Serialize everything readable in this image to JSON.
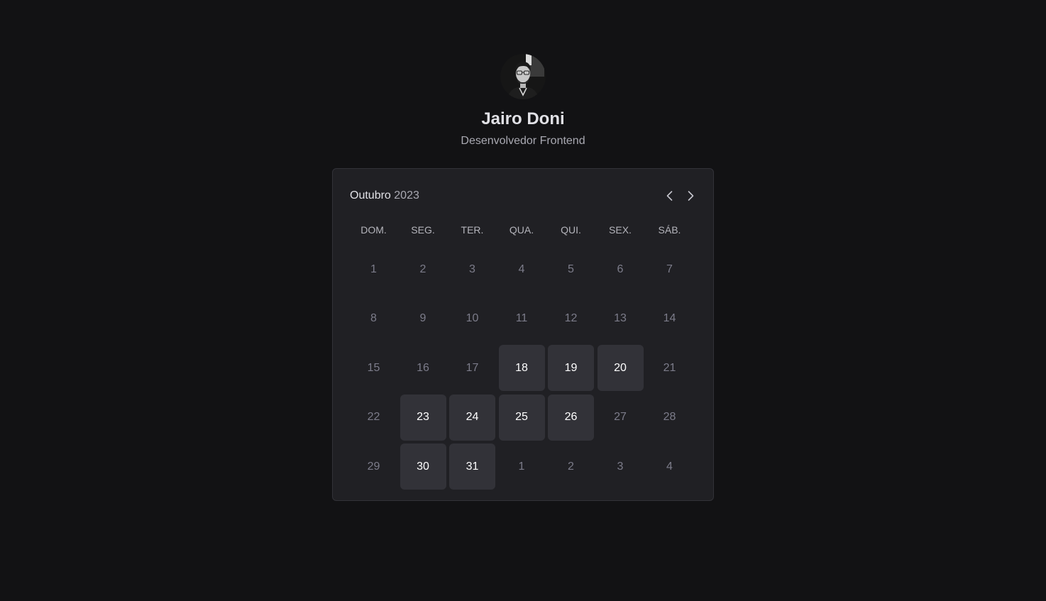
{
  "profile": {
    "name": "Jairo Doni",
    "role": "Desenvolvedor Frontend"
  },
  "calendar": {
    "month": "Outubro",
    "year": "2023",
    "weekdays": [
      "DOM.",
      "SEG.",
      "TER.",
      "QUA.",
      "QUI.",
      "SEX.",
      "SÁB."
    ],
    "days": [
      {
        "label": "1",
        "available": false
      },
      {
        "label": "2",
        "available": false
      },
      {
        "label": "3",
        "available": false
      },
      {
        "label": "4",
        "available": false
      },
      {
        "label": "5",
        "available": false
      },
      {
        "label": "6",
        "available": false
      },
      {
        "label": "7",
        "available": false
      },
      {
        "label": "8",
        "available": false
      },
      {
        "label": "9",
        "available": false
      },
      {
        "label": "10",
        "available": false
      },
      {
        "label": "11",
        "available": false
      },
      {
        "label": "12",
        "available": false
      },
      {
        "label": "13",
        "available": false
      },
      {
        "label": "14",
        "available": false
      },
      {
        "label": "15",
        "available": false
      },
      {
        "label": "16",
        "available": false
      },
      {
        "label": "17",
        "available": false
      },
      {
        "label": "18",
        "available": true
      },
      {
        "label": "19",
        "available": true
      },
      {
        "label": "20",
        "available": true
      },
      {
        "label": "21",
        "available": false
      },
      {
        "label": "22",
        "available": false
      },
      {
        "label": "23",
        "available": true
      },
      {
        "label": "24",
        "available": true
      },
      {
        "label": "25",
        "available": true
      },
      {
        "label": "26",
        "available": true
      },
      {
        "label": "27",
        "available": false
      },
      {
        "label": "28",
        "available": false
      },
      {
        "label": "29",
        "available": false
      },
      {
        "label": "30",
        "available": true
      },
      {
        "label": "31",
        "available": true
      },
      {
        "label": "1",
        "available": false
      },
      {
        "label": "2",
        "available": false
      },
      {
        "label": "3",
        "available": false
      },
      {
        "label": "4",
        "available": false
      }
    ],
    "prev_icon": "chevron-left-icon",
    "next_icon": "chevron-right-icon"
  },
  "colors": {
    "background": "#121214",
    "card": "#202024",
    "available_day": "#323238",
    "text_primary": "#e1e1e6",
    "text_muted": "#7c7c8a"
  }
}
